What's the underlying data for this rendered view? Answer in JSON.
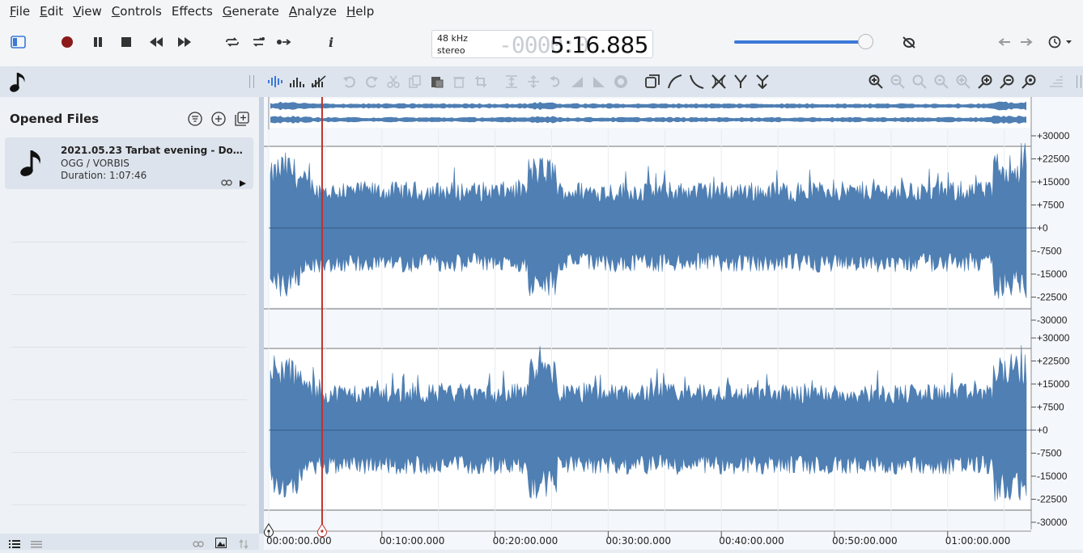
{
  "menu": [
    {
      "label": "File",
      "key": "F",
      "rest": "ile"
    },
    {
      "label": "Edit",
      "key": "E",
      "rest": "dit"
    },
    {
      "label": "View",
      "key": "V",
      "rest": "iew"
    },
    {
      "label": "Controls",
      "key": "C",
      "rest": "ontrols"
    },
    {
      "label": "Effects",
      "key": "",
      "rest": "Effects"
    },
    {
      "label": "Generate",
      "key": "G",
      "rest": "enerate"
    },
    {
      "label": "Analyze",
      "key": "A",
      "rest": "nalyze"
    },
    {
      "label": "Help",
      "key": "H",
      "rest": "elp"
    }
  ],
  "transport": {
    "sample_rate": "48 kHz",
    "channels": "stereo",
    "ghost_digits": "-0000:0",
    "time": "5:16.885",
    "volume_level": 0.95
  },
  "sidebar": {
    "title": "Opened Files",
    "file": {
      "name": "2021.05.23 Tarbat evening - Donald ...",
      "format": "OGG / VORBIS",
      "duration": "Duration: 1:07:46"
    }
  },
  "waveform": {
    "color": "#4f7fb3",
    "cursor_color": "#c0312b",
    "cursor_time_fraction": 0.07,
    "y_ticks": [
      "+30000",
      "+22500",
      "+15000",
      "+7500",
      "+0",
      "-7500",
      "-15000",
      "-22500",
      "-30000"
    ],
    "time_ticks": [
      "00:00:00.000",
      "00:10:00.000",
      "00:20:00.000",
      "00:30:00.000",
      "00:40:00.000",
      "00:50:00.000",
      "01:00:00.000"
    ]
  }
}
